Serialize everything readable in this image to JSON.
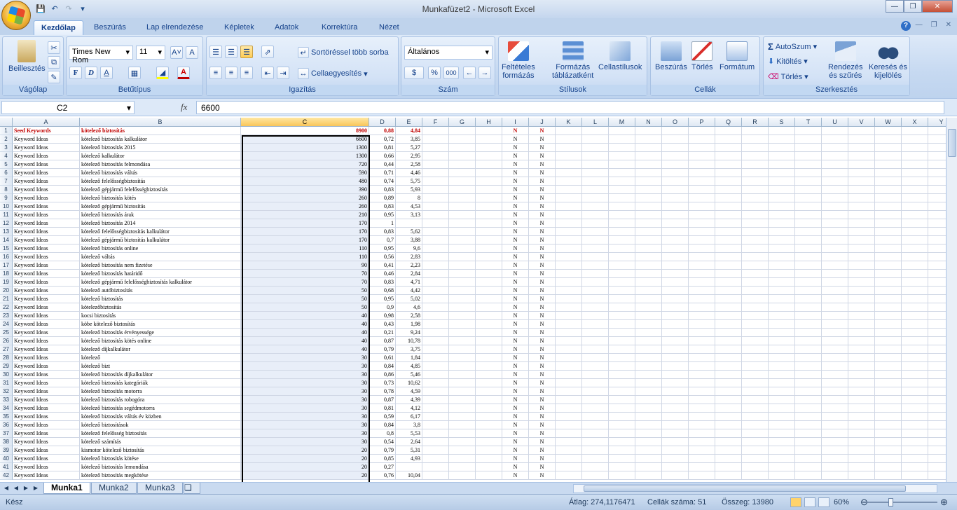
{
  "title": "Munkafüzet2 - Microsoft Excel",
  "tabs": [
    "Kezdőlap",
    "Beszúrás",
    "Lap elrendezése",
    "Képletek",
    "Adatok",
    "Korrektúra",
    "Nézet"
  ],
  "ribbon": {
    "clipboard": {
      "label": "Vágólap",
      "paste": "Beillesztés"
    },
    "font": {
      "label": "Betűtípus",
      "name": "Times New Rom",
      "size": "11",
      "bold": "F",
      "italic": "D",
      "underline": "A"
    },
    "align": {
      "label": "Igazítás",
      "wrap": "Sortöréssel több sorba",
      "merge": "Cellaegyesítés"
    },
    "number": {
      "label": "Szám",
      "format": "Általános",
      "percent": "%",
      "thousands": "000"
    },
    "styles": {
      "label": "Stílusok",
      "cond": "Feltételes\nformázás",
      "table": "Formázás\ntáblázatként",
      "cell": "Cellastílusok"
    },
    "cells": {
      "label": "Cellák",
      "insert": "Beszúrás",
      "delete": "Törlés",
      "format": "Formátum"
    },
    "editing": {
      "label": "Szerkesztés",
      "autosum": "AutoSzum",
      "fill": "Kitöltés",
      "clear": "Törlés",
      "sort": "Rendezés\nés szűrés",
      "find": "Keresés és\nkijelölés"
    }
  },
  "formula": {
    "namebox": "C2",
    "fx": "fx",
    "value": "6600"
  },
  "columns": [
    "A",
    "B",
    "C",
    "D",
    "E",
    "F",
    "G",
    "H",
    "I",
    "J",
    "K",
    "L",
    "M",
    "N",
    "O",
    "P",
    "Q",
    "R",
    "S",
    "T",
    "U",
    "V",
    "W",
    "X",
    "Y"
  ],
  "rows": [
    [
      "Seed Keywords",
      "kötelező biztosítás",
      "8900",
      "0,88",
      "4,84",
      "N",
      "N"
    ],
    [
      "Keyword Ideas",
      "kötelező biztosítás kalkulátor",
      "6600",
      "0,72",
      "3,85",
      "N",
      "N"
    ],
    [
      "Keyword Ideas",
      "kötelező biztosítás 2015",
      "1300",
      "0,81",
      "5,27",
      "N",
      "N"
    ],
    [
      "Keyword Ideas",
      "kötelező kalkulátor",
      "1300",
      "0,66",
      "2,95",
      "N",
      "N"
    ],
    [
      "Keyword Ideas",
      "kötelező biztosítás felmondása",
      "720",
      "0,44",
      "2,58",
      "N",
      "N"
    ],
    [
      "Keyword Ideas",
      "kötelező biztosítás váltás",
      "590",
      "0,71",
      "4,46",
      "N",
      "N"
    ],
    [
      "Keyword Ideas",
      "kötelező felelősségbiztosítás",
      "480",
      "0,74",
      "5,75",
      "N",
      "N"
    ],
    [
      "Keyword Ideas",
      "kötelező gépjármű felelősségbiztosítás",
      "390",
      "0,83",
      "5,93",
      "N",
      "N"
    ],
    [
      "Keyword Ideas",
      "kötelező biztosítás kötés",
      "260",
      "0,89",
      "8",
      "N",
      "N"
    ],
    [
      "Keyword Ideas",
      "kötelező gépjármű biztosítás",
      "260",
      "0,83",
      "4,53",
      "N",
      "N"
    ],
    [
      "Keyword Ideas",
      "kötelező biztosítás árak",
      "210",
      "0,95",
      "3,13",
      "N",
      "N"
    ],
    [
      "Keyword Ideas",
      "kötelező biztosítás 2014",
      "170",
      "1",
      "",
      "N",
      "N"
    ],
    [
      "Keyword Ideas",
      "kötelező felelősségbiztosítás kalkulátor",
      "170",
      "0,83",
      "5,62",
      "N",
      "N"
    ],
    [
      "Keyword Ideas",
      "kötelező gépjármű biztosítás kalkulátor",
      "170",
      "0,7",
      "3,88",
      "N",
      "N"
    ],
    [
      "Keyword Ideas",
      "kötelező biztosítás online",
      "110",
      "0,95",
      "9,6",
      "N",
      "N"
    ],
    [
      "Keyword Ideas",
      "kötelező váltás",
      "110",
      "0,56",
      "2,83",
      "N",
      "N"
    ],
    [
      "Keyword Ideas",
      "kötelező biztosítás nem fizetése",
      "90",
      "0,41",
      "2,23",
      "N",
      "N"
    ],
    [
      "Keyword Ideas",
      "kötelező biztosítás határidő",
      "70",
      "0,46",
      "2,84",
      "N",
      "N"
    ],
    [
      "Keyword Ideas",
      "kötelező gépjármű felelősségbiztosítás kalkulátor",
      "70",
      "0,83",
      "4,71",
      "N",
      "N"
    ],
    [
      "Keyword Ideas",
      "kötelező autóbiztosítás",
      "50",
      "0,68",
      "4,42",
      "N",
      "N"
    ],
    [
      "Keyword Ideas",
      "kötelező biztosítás",
      "50",
      "0,95",
      "5,02",
      "N",
      "N"
    ],
    [
      "Keyword Ideas",
      "kötelezőbiztosítás",
      "50",
      "0,9",
      "4,6",
      "N",
      "N"
    ],
    [
      "Keyword Ideas",
      "kocsi biztosítás",
      "40",
      "0,98",
      "2,58",
      "N",
      "N"
    ],
    [
      "Keyword Ideas",
      "köbe kötelező biztosítás",
      "40",
      "0,43",
      "1,98",
      "N",
      "N"
    ],
    [
      "Keyword Ideas",
      "kötelező biztosítás érvényessége",
      "40",
      "0,21",
      "9,24",
      "N",
      "N"
    ],
    [
      "Keyword Ideas",
      "kötelező biztosítás kötés online",
      "40",
      "0,87",
      "10,78",
      "N",
      "N"
    ],
    [
      "Keyword Ideas",
      "kötelező díjkalkulátor",
      "40",
      "0,79",
      "3,75",
      "N",
      "N"
    ],
    [
      "Keyword Ideas",
      "kötelező",
      "30",
      "0,61",
      "1,84",
      "N",
      "N"
    ],
    [
      "Keyword Ideas",
      "kötelező bizt",
      "30",
      "0,84",
      "4,85",
      "N",
      "N"
    ],
    [
      "Keyword Ideas",
      "kötelező biztosítás díjkalkulátor",
      "30",
      "0,86",
      "5,46",
      "N",
      "N"
    ],
    [
      "Keyword Ideas",
      "kötelező biztosítás kategóriák",
      "30",
      "0,73",
      "10,62",
      "N",
      "N"
    ],
    [
      "Keyword Ideas",
      "kötelező biztosítás motorra",
      "30",
      "0,78",
      "4,59",
      "N",
      "N"
    ],
    [
      "Keyword Ideas",
      "kötelező biztosítás robogóra",
      "30",
      "0,87",
      "4,39",
      "N",
      "N"
    ],
    [
      "Keyword Ideas",
      "kötelező biztosítás segédmotorra",
      "30",
      "0,81",
      "4,12",
      "N",
      "N"
    ],
    [
      "Keyword Ideas",
      "kötelező biztosítás váltás év közben",
      "30",
      "0,59",
      "6,17",
      "N",
      "N"
    ],
    [
      "Keyword Ideas",
      "kötelező biztosítások",
      "30",
      "0,84",
      "3,8",
      "N",
      "N"
    ],
    [
      "Keyword Ideas",
      "kötelező felelősség biztosítás",
      "30",
      "0,8",
      "5,53",
      "N",
      "N"
    ],
    [
      "Keyword Ideas",
      "kötelező számítás",
      "30",
      "0,54",
      "2,64",
      "N",
      "N"
    ],
    [
      "Keyword Ideas",
      "kismotor kötelező biztosítás",
      "20",
      "0,79",
      "5,31",
      "N",
      "N"
    ],
    [
      "Keyword Ideas",
      "kötelező biztosítás kötése",
      "20",
      "0,85",
      "4,93",
      "N",
      "N"
    ],
    [
      "Keyword Ideas",
      "kötelező biztosítás lemondása",
      "20",
      "0,27",
      "",
      "N",
      "N"
    ],
    [
      "Keyword Ideas",
      "kötelező biztosítás megkötése",
      "20",
      "0,76",
      "10,04",
      "N",
      "N"
    ]
  ],
  "sheets": [
    "Munka1",
    "Munka2",
    "Munka3"
  ],
  "status": {
    "ready": "Kész",
    "avg": "Átlag: 274,1176471",
    "count": "Cellák száma: 51",
    "sum": "Összeg: 13980",
    "zoom": "60%"
  }
}
